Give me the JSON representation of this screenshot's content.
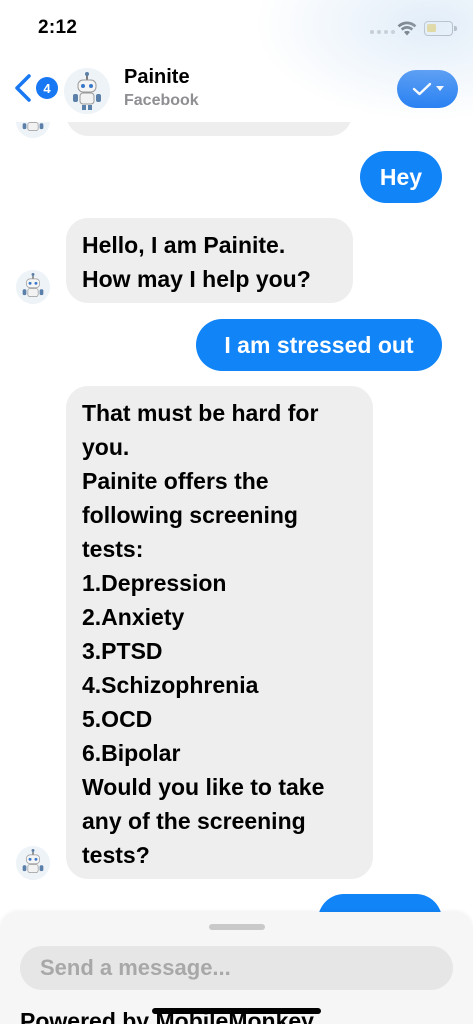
{
  "status_bar": {
    "time": "2:12",
    "signal_icon": "signal-dots-icon",
    "wifi_icon": "wifi-icon",
    "battery_icon": "battery-icon",
    "battery_color": "#f4c20d"
  },
  "header": {
    "back_icon": "chevron-left-icon",
    "unread_count": "4",
    "page_name": "Painite",
    "page_subtitle": "Facebook",
    "avatar_icon": "robot-avatar-icon",
    "action_icon": "checkmark-dropdown-icon",
    "accent_color": "#1877f2"
  },
  "messages": [
    {
      "sender": "bot",
      "text": ""
    },
    {
      "sender": "user",
      "text": "Hey"
    },
    {
      "sender": "bot",
      "text": "Hello, I am Painite.\nHow may I help you?"
    },
    {
      "sender": "user",
      "text": "I am stressed out"
    },
    {
      "sender": "bot",
      "text": "That must be hard for you.\n Painite offers the following screening tests:\n 1.Depression\n 2.Anxiety\n 3.PTSD\n 4.Schizophrenia\n 5.OCD\n 6.Bipolar\n Would you like to take any of the screening tests?"
    },
    {
      "sender": "user",
      "text": ""
    }
  ],
  "composer": {
    "placeholder": "Send a message...",
    "powered_by": "Powered by MobileMonkey"
  },
  "colors": {
    "outgoing_bubble": "#1184f8",
    "incoming_bubble": "#eeeeee"
  }
}
